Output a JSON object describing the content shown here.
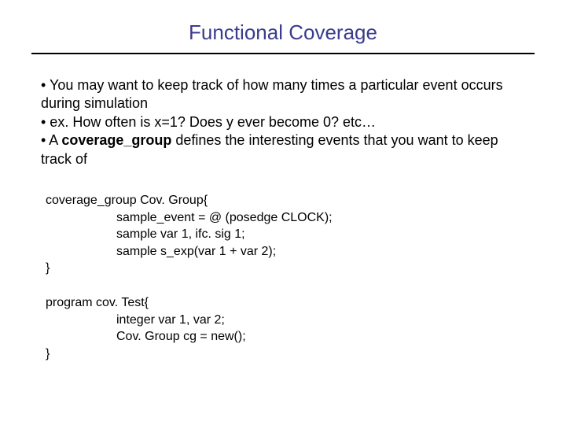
{
  "title": "Functional Coverage",
  "bullets": {
    "b1": "• You may want to keep track of how many times a particular event occurs during simulation",
    "b2": "• ex. How often is x=1? Does y ever become 0? etc…",
    "b3_prefix": "• A ",
    "b3_bold": "coverage_group",
    "b3_suffix": " defines the interesting events that you want to keep track of"
  },
  "code1": {
    "l1": "coverage_group Cov. Group{",
    "l2": "sample_event = @ (posedge CLOCK);",
    "l3": "sample var 1, ifc. sig 1;",
    "l4": "sample s_exp(var 1 + var 2);",
    "l5": "}"
  },
  "code2": {
    "l1": "program cov. Test{",
    "l2": "integer var 1, var 2;",
    "l3": "Cov. Group cg = new();",
    "l4": "}"
  }
}
